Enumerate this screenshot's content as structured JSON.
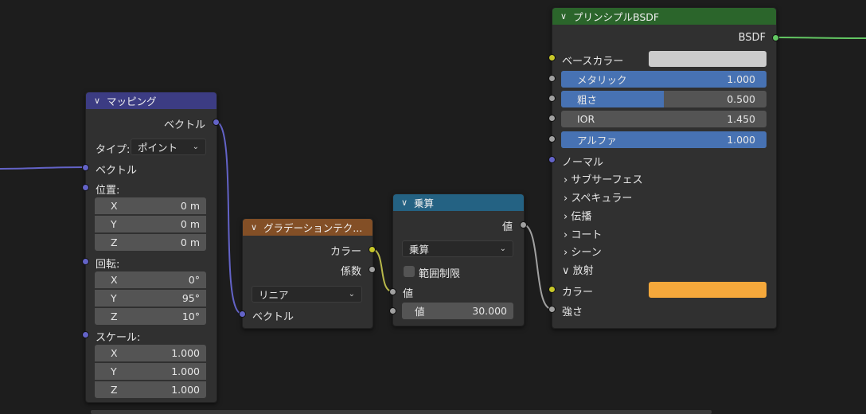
{
  "colors": {
    "mapping_header": "#3c3c83",
    "gradient_header": "#834f26",
    "math_header": "#246283",
    "bsdf_header": "#2b652b",
    "base_color_swatch": "#cccccc",
    "emission_color_swatch": "#f5a83b"
  },
  "mapping": {
    "title": "マッピング",
    "out_vector": "ベクトル",
    "type_label": "タイプ:",
    "type_value": "ポイント",
    "in_vector": "ベクトル",
    "location_label": "位置:",
    "location": [
      {
        "k": "X",
        "v": "0 m"
      },
      {
        "k": "Y",
        "v": "0 m"
      },
      {
        "k": "Z",
        "v": "0 m"
      }
    ],
    "rotation_label": "回転:",
    "rotation": [
      {
        "k": "X",
        "v": "0°"
      },
      {
        "k": "Y",
        "v": "95°"
      },
      {
        "k": "Z",
        "v": "10°"
      }
    ],
    "scale_label": "スケール:",
    "scale": [
      {
        "k": "X",
        "v": "1.000"
      },
      {
        "k": "Y",
        "v": "1.000"
      },
      {
        "k": "Z",
        "v": "1.000"
      }
    ]
  },
  "gradient": {
    "title": "グラデーションテク...",
    "out_color": "カラー",
    "out_fac": "係数",
    "type_value": "リニア",
    "in_vector": "ベクトル"
  },
  "math": {
    "title": "乗算",
    "out_value": "値",
    "operation": "乗算",
    "clamp_label": "範囲制限",
    "in_value": "値",
    "value_field_label": "値",
    "value_field_value": "30.000"
  },
  "bsdf": {
    "title": "プリンシプルBSDF",
    "out_bsdf": "BSDF",
    "base_color": "ベースカラー",
    "metallic": {
      "k": "メタリック",
      "v": "1.000",
      "fill": 1.0
    },
    "roughness": {
      "k": "粗さ",
      "v": "0.500",
      "fill": 0.5
    },
    "ior": {
      "k": "IOR",
      "v": "1.450",
      "fill": 0.0
    },
    "alpha": {
      "k": "アルファ",
      "v": "1.000",
      "fill": 1.0
    },
    "normal": "ノーマル",
    "panels": [
      "サブサーフェス",
      "スペキュラー",
      "伝播",
      "コート",
      "シーン"
    ],
    "emission_panel": "放射",
    "emission_color": "カラー",
    "emission_strength": "強さ"
  }
}
